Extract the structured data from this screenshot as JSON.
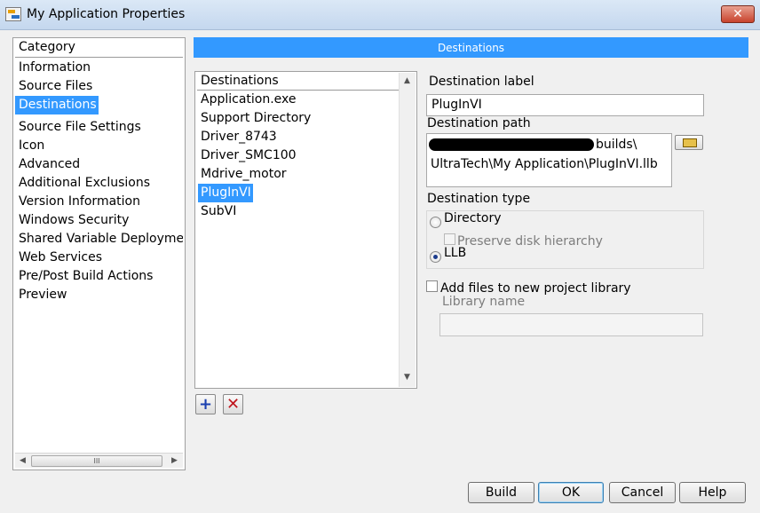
{
  "window": {
    "title": "My Application Properties",
    "close_glyph": "✕"
  },
  "category": {
    "header": "Category",
    "items": [
      "Information",
      "Source Files",
      "Destinations",
      "Source File Settings",
      "Icon",
      "Advanced",
      "Additional Exclusions",
      "Version Information",
      "Windows Security",
      "Shared Variable Deploymen",
      "Web Services",
      "Pre/Post Build Actions",
      "Preview"
    ],
    "selected": "Destinations",
    "scroll_thumb_glyph": "III"
  },
  "section": {
    "title": "Destinations"
  },
  "destinations": {
    "header": "Destinations",
    "items": [
      "Application.exe",
      "Support Directory",
      "Driver_8743",
      "Driver_SMC100",
      "Mdrive_motor",
      "PlugInVI",
      "SubVI"
    ],
    "selected": "PlugInVI",
    "add_glyph": "+",
    "remove_glyph": "✕"
  },
  "form": {
    "dest_label_title": "Destination label",
    "dest_label_value": "PlugInVI",
    "dest_path_title": "Destination path",
    "dest_path_line1": "builds\\",
    "dest_path_line2": "UltraTech\\My Application\\PlugInVI.llb",
    "dest_type_title": "Destination type",
    "option_directory": "Directory",
    "option_preserve": "Preserve disk hierarchy",
    "option_llb": "LLB",
    "add_files_label": "Add files to new project library",
    "library_name_label": "Library name",
    "library_name_value": ""
  },
  "buttons": {
    "build": "Build",
    "ok": "OK",
    "cancel": "Cancel",
    "help": "Help"
  }
}
